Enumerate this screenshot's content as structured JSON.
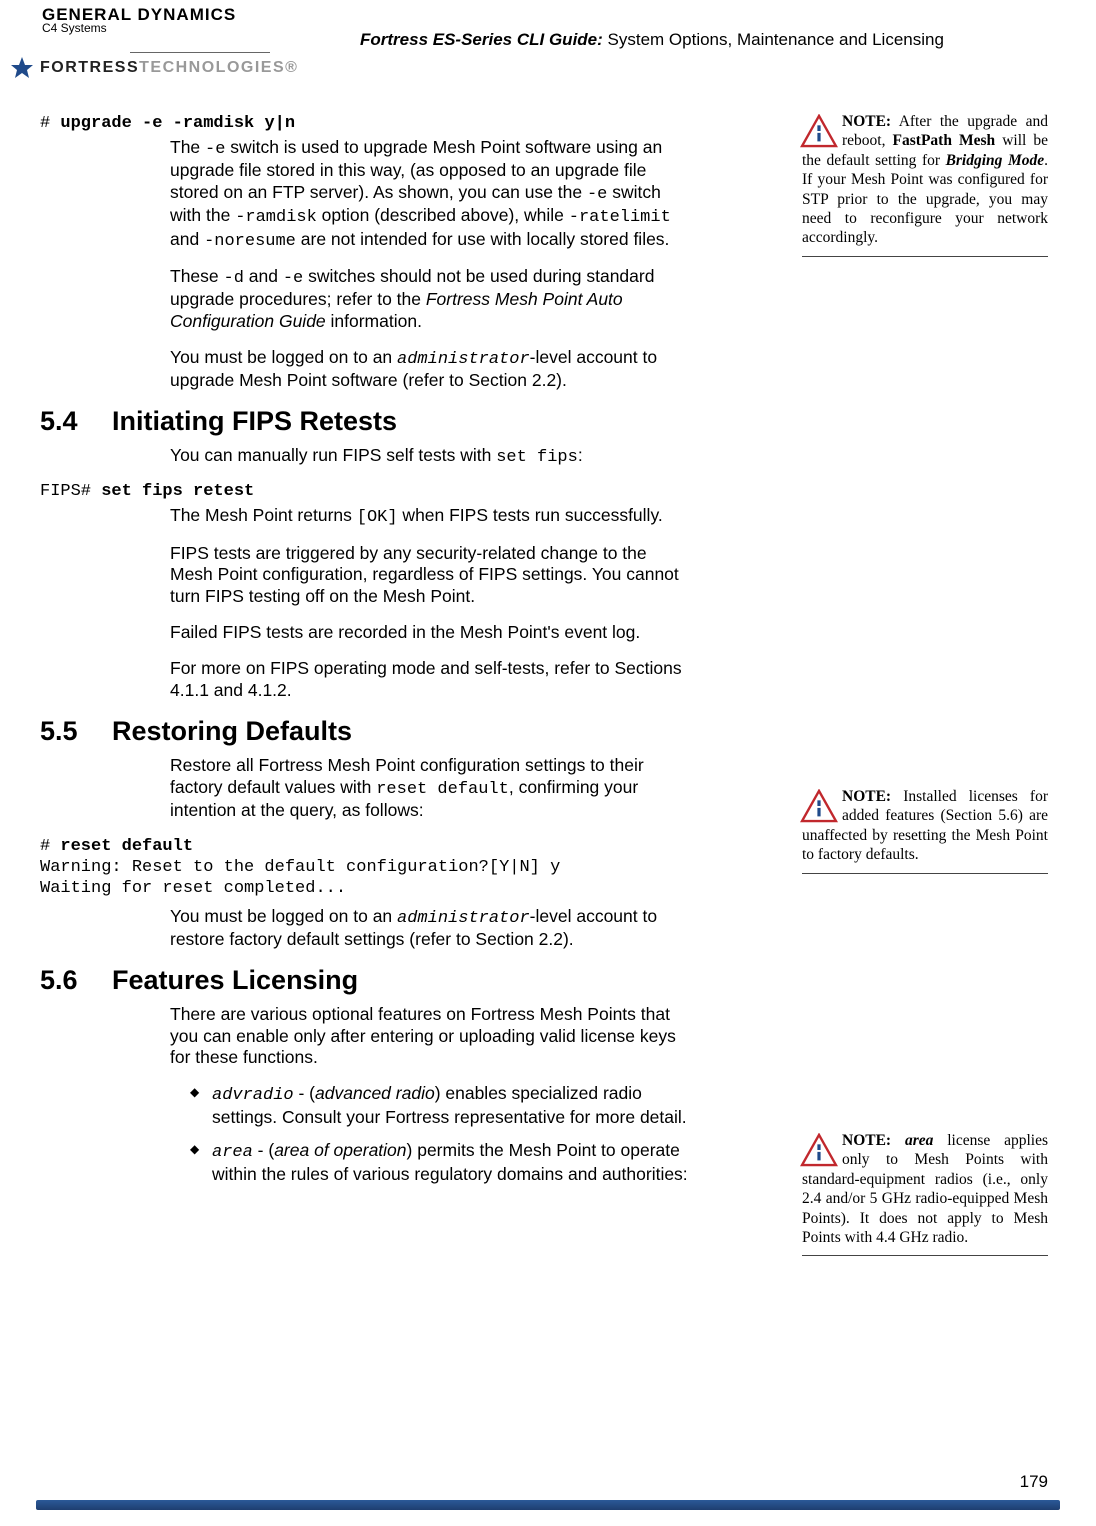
{
  "header": {
    "company": "GENERAL DYNAMICS",
    "company_sub": "C4 Systems",
    "logo2_strong": "FORTRESS",
    "logo2_light": "TECHNOLOGIES®",
    "doc_title_bold": "Fortress ES-Series CLI Guide:",
    "doc_title_rest": " System Options, Maintenance and Licensing"
  },
  "cmds": {
    "c1_prefix": "# ",
    "c1_bold": "upgrade -e -ramdisk y|n",
    "fips_prefix": "FIPS# ",
    "fips_bold": "set fips retest",
    "reset_prefix": "# ",
    "reset_bold": "reset default",
    "reset_line2": "Warning: Reset to the default configuration?[Y|N] y",
    "reset_line3": "Waiting for reset completed..."
  },
  "para": {
    "p1a": "The ",
    "p1b": "-e",
    "p1c": " switch is used to upgrade Mesh Point software using an upgrade file stored in this way, (as opposed to an upgrade file stored on an FTP server). As shown, you can use the ",
    "p1d": "-e",
    "p1e": " switch with the ",
    "p1f": "-ramdisk",
    "p1g": " option (described above), while ",
    "p1h": "-ratelimit",
    "p1i": " and ",
    "p1j": "-noresume",
    "p1k": " are not intended for use with locally stored files.",
    "p2a": "These ",
    "p2b": "-d",
    "p2c": " and ",
    "p2d": "-e",
    "p2e": " switches should not be used during standard upgrade procedures; refer to the ",
    "p2f": "Fortress Mesh Point Auto Configuration Guide",
    "p2g": " information.",
    "p3a": "You must be logged on to an ",
    "p3b": "administrator",
    "p3c": "-level account to upgrade Mesh Point software (refer to Section 2.2).",
    "p4a": "You can manually run FIPS self tests with ",
    "p4b": "set fips",
    "p4c": ":",
    "p5a": "The Mesh Point returns ",
    "p5b": "[OK]",
    "p5c": " when FIPS tests run successfully.",
    "p6": "FIPS tests are triggered by any security-related change to the Mesh Point configuration, regardless of FIPS settings. You cannot turn FIPS testing off on the Mesh Point.",
    "p7": "Failed FIPS tests are recorded in the Mesh Point's event log.",
    "p8": "For more on FIPS operating mode and self-tests, refer to Sections 4.1.1 and 4.1.2.",
    "p9a": "Restore all Fortress Mesh Point configuration settings to their factory default values with ",
    "p9b": "reset default",
    "p9c": ", confirming your intention at the query, as follows:",
    "p10a": "You must be logged on to an ",
    "p10b": "administrator",
    "p10c": "-level account to restore factory default settings (refer to Section 2.2).",
    "p11": "There are various optional features on Fortress Mesh Points that you can enable only after entering or uploading valid license keys for these functions."
  },
  "sections": {
    "s54_num": "5.4",
    "s54_title": "Initiating FIPS Retests",
    "s55_num": "5.5",
    "s55_title": "Restoring Defaults",
    "s56_num": "5.6",
    "s56_title": "Features Licensing"
  },
  "features": {
    "f1_code": "advradio",
    "f1_sep": " - (",
    "f1_ital": "advanced radio",
    "f1_rest": ") enables specialized radio settings. Consult your Fortress representative for more detail.",
    "f2_code": "area",
    "f2_sep": " - (",
    "f2_ital": "area of operation",
    "f2_rest": ") permits the Mesh Point to operate within the rules of various regulatory domains and authorities:"
  },
  "notes": {
    "n1_label": "NOTE:",
    "n1_a": " After the upgrade and reboot, ",
    "n1_b": "FastPath Mesh",
    "n1_c": " will be the default setting for ",
    "n1_d": "Bridging Mode",
    "n1_e": ". If your Mesh Point was configured for STP prior to the upgrade, you may need to reconfigure your network accordingly.",
    "n2_label": "NOTE:",
    "n2_a": " Installed licenses for added features (Section 5.6) are unaffected by resetting the Mesh Point to factory defaults.",
    "n3_label": "NOTE:",
    "n3_a": " ",
    "n3_b": "area",
    "n3_c": " license applies only to Mesh Points with standard-equipment radios (i.e., only 2.4 and/or 5 GHz radio-equipped Mesh Points). It does not apply to Mesh Points with 4.4 GHz radio."
  },
  "footer": {
    "page": "179"
  }
}
